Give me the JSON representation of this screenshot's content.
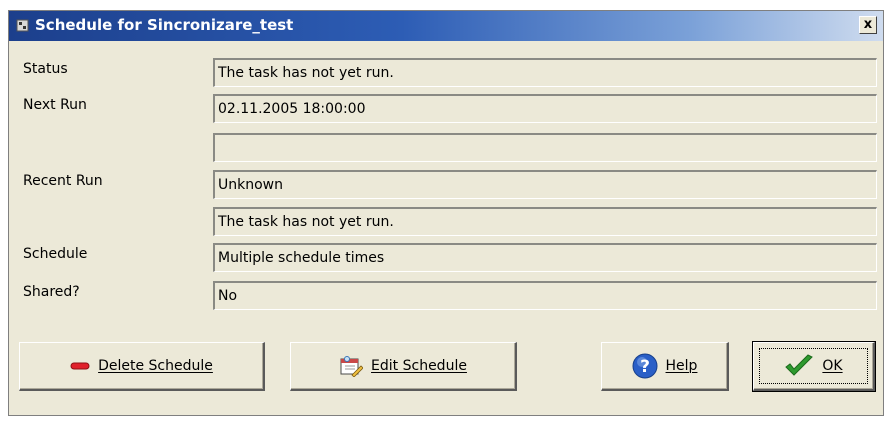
{
  "window": {
    "title": "Schedule for Sincronizare_test",
    "close_label": "x"
  },
  "fields": {
    "status": {
      "label": "Status",
      "value": "The task has not yet run."
    },
    "next_run": {
      "label": "Next Run",
      "value": "02.11.2005 18:00:00",
      "value2": ""
    },
    "recent_run": {
      "label": "Recent Run",
      "value": "Unknown",
      "value2": "The task has not yet run."
    },
    "schedule": {
      "label": "Schedule",
      "value": "Multiple schedule times"
    },
    "shared": {
      "label": "Shared?",
      "value": "No"
    }
  },
  "buttons": {
    "delete": {
      "label": "Delete Schedule",
      "icon": "minus-icon",
      "color": "#e0202a"
    },
    "edit": {
      "label": "Edit Schedule",
      "icon": "edit-schedule-icon"
    },
    "help": {
      "label": "Help",
      "icon": "help-icon",
      "color": "#2a5fc7"
    },
    "ok": {
      "label": "OK",
      "icon": "checkmark-icon",
      "color": "#2e9a2e"
    }
  }
}
